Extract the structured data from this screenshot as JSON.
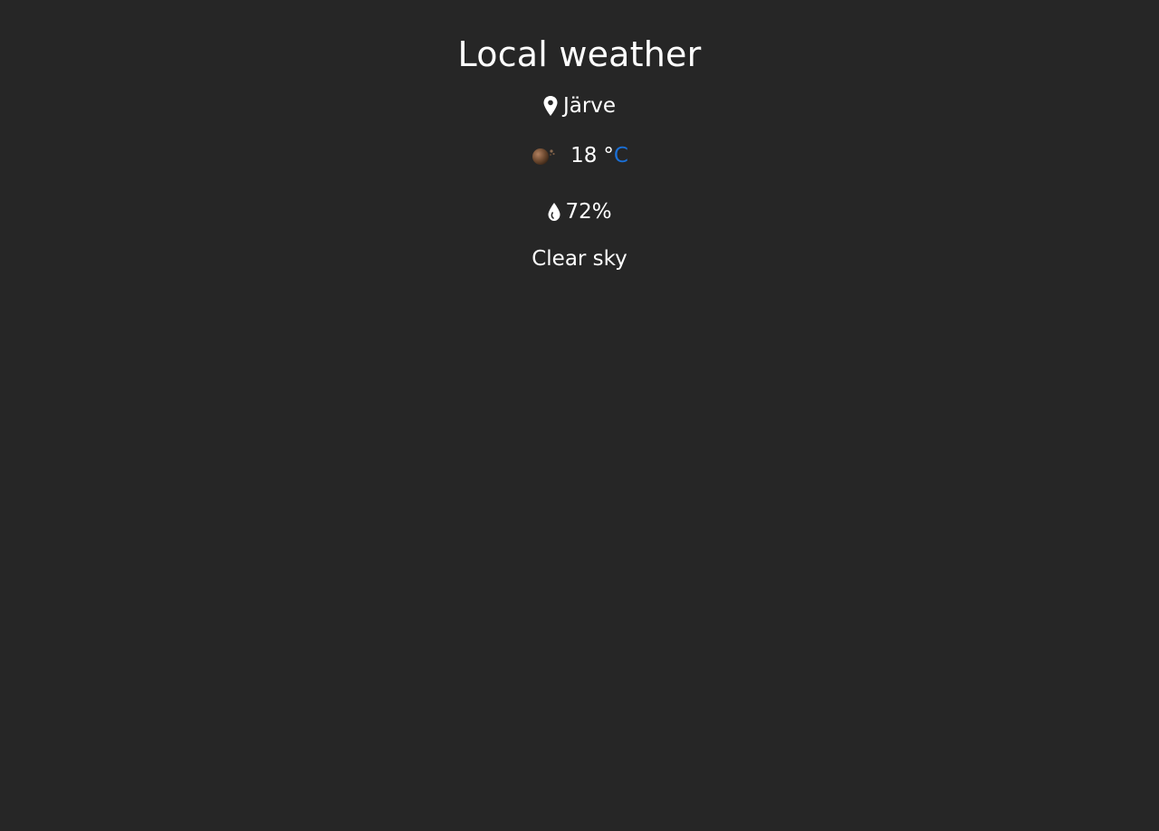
{
  "header": {
    "title": "Local weather"
  },
  "location": {
    "icon": "map-pin-icon",
    "name": "Järve"
  },
  "temperature": {
    "icon": "weather-condition-icon",
    "value": "18",
    "degree_symbol": "°",
    "unit": "C",
    "unit_color": "#1a6fd6"
  },
  "humidity": {
    "icon": "water-drop-icon",
    "value": "72%"
  },
  "conditions": {
    "description": "Clear sky"
  },
  "colors": {
    "background": "#262626",
    "text": "#ffffff"
  }
}
